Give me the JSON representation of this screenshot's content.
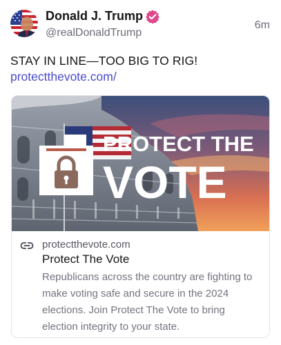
{
  "author": {
    "name": "Donald J. Trump",
    "handle": "@realDonaldTrump",
    "verified": true,
    "avatar_icon": "flag-portrait-avatar",
    "verified_icon": "verified-badge-icon",
    "verified_color": "#e0468a"
  },
  "post": {
    "timestamp": "6m",
    "text": "STAY IN LINE—TOO BIG TO RIG!",
    "link": "protectthevote.com/",
    "link_color": "#4a4acb"
  },
  "card": {
    "image": {
      "headline_line1": "PROTECT THE",
      "headline_line2": "VOTE",
      "icon": "ballot-box-lock-icon"
    },
    "link_icon": "link-icon",
    "domain": "protectthevote.com",
    "title": "Protect The Vote",
    "description": "Republicans across the country are fighting to make voting safe and secure in the 2024 elections. Join Protect The Vote to bring election integrity to your state."
  }
}
